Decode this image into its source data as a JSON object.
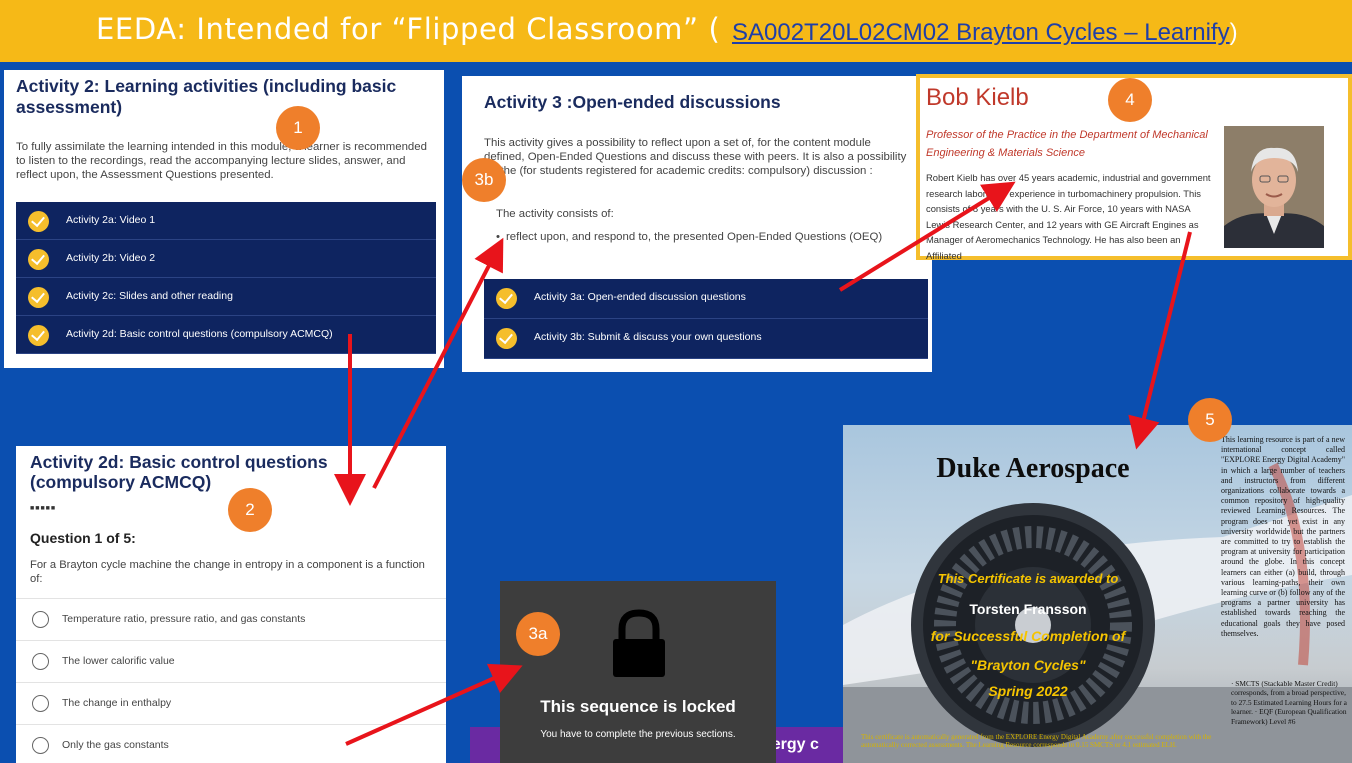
{
  "header": {
    "title": "EEDA: Intended for “Flipped Classroom” (",
    "link": "SA002T20L02CM02 Brayton Cycles – Learnify",
    "close_paren": ")"
  },
  "panel1": {
    "title": "Activity 2: Learning activities (including basic assessment)",
    "description": "To fully assimilate the learning intended in this module, a learner is recommended to listen to the recordings, read the accompanying lecture slides, answer, and reflect upon, the Assessment Questions presented.",
    "activities": [
      "Activity 2a: Video 1",
      "Activity 2b: Video 2",
      "Activity 2c: Slides and other reading",
      "Activity 2d: Basic control questions (compulsory ACMCQ)"
    ]
  },
  "panel3": {
    "title": "Activity 3 :Open-ended discussions",
    "description": "This activity gives a possibility to reflect upon a set of, for the content module defined, Open-Ended Questions and discuss these with peers. It is also a possibility for the (for students registered for academic credits: compulsory) discussion :",
    "consists": "The activity consists of:",
    "bullet": "reflect upon, and respond to, the presented Open-Ended Questions (OEQ)",
    "activities": [
      "Activity 3a: Open-ended discussion questions",
      "Activity 3b: Submit & discuss your own questions"
    ]
  },
  "profile": {
    "name": "Bob Kielb",
    "role": "Professor of the Practice in the Department of Mechanical Engineering & Materials Science",
    "bio": "Robert Kielb has over 45 years academic, industrial and government research laboratory experience in turbomachinery propulsion. This consists of 8 years with the U. S. Air Force, 10 years with NASA Lewis Research Center, and 12 years with GE Aircraft Engines as Manager of Aeromechanics Technology. He has also been an Affiliated"
  },
  "quiz": {
    "title": "Activity 2d: Basic control questions (compulsory ACMCQ)",
    "progress": "■■■■■",
    "question_number": "Question 1 of 5:",
    "question": "For a Brayton cycle machine the change in entropy in a component is a function of:",
    "options": [
      "Temperature ratio, pressure ratio, and gas constants",
      "The lower calorific value",
      "The change in enthalpy",
      "Only the gas constants"
    ]
  },
  "locked": {
    "title": "This sequence is locked",
    "subtitle": "You have to complete the previous sections.",
    "background_text": "nergy c"
  },
  "certificate": {
    "title": "Duke Aerospace",
    "awarded": "This Certificate is awarded to",
    "person": "Torsten Fransson",
    "completion": "for Successful Completion of",
    "course": "\"Brayton Cycles\"",
    "term": "Spring 2022",
    "side_text": "This learning resource is part of a new international concept called \"EXPLORE Energy Digital Academy\" in which a large number of teachers and instructors from different organizations collaborate towards a common repository of high-quality reviewed Learning Resources. The program does not yet exist in any university worldwide but the partners are committed to try to establish the program at university for participation around the globe. In this concept learners can either (a) build, through various learning-paths, their own learning curve or (b) follow any of the programs a partner university has established towards reaching the educational goals they have posed themselves.",
    "credits_text": "· SMCTS (Stackable Master Credit) corresponds, from a broad perspective, to 27.5 Estimated Learning Hours for a learner. · EQF (European Qualification Framework) Level #6",
    "footer": "This certificate is automatically generated from the EXPLORE Energy Digital Academy after successful completion with the automatically corrected assessments. The Learning Resource corresponds to 0.15 SMCTS or 4.1 estimated ELH."
  },
  "badges": [
    "1",
    "2",
    "3a",
    "3b",
    "4",
    "5"
  ],
  "colors": {
    "background": "#0b4fb0",
    "title_bar": "#f6b917",
    "activity_row": "#0e2460",
    "check": "#f5be2c",
    "badge": "#ef7f2b",
    "arrow": "#e8141b"
  }
}
